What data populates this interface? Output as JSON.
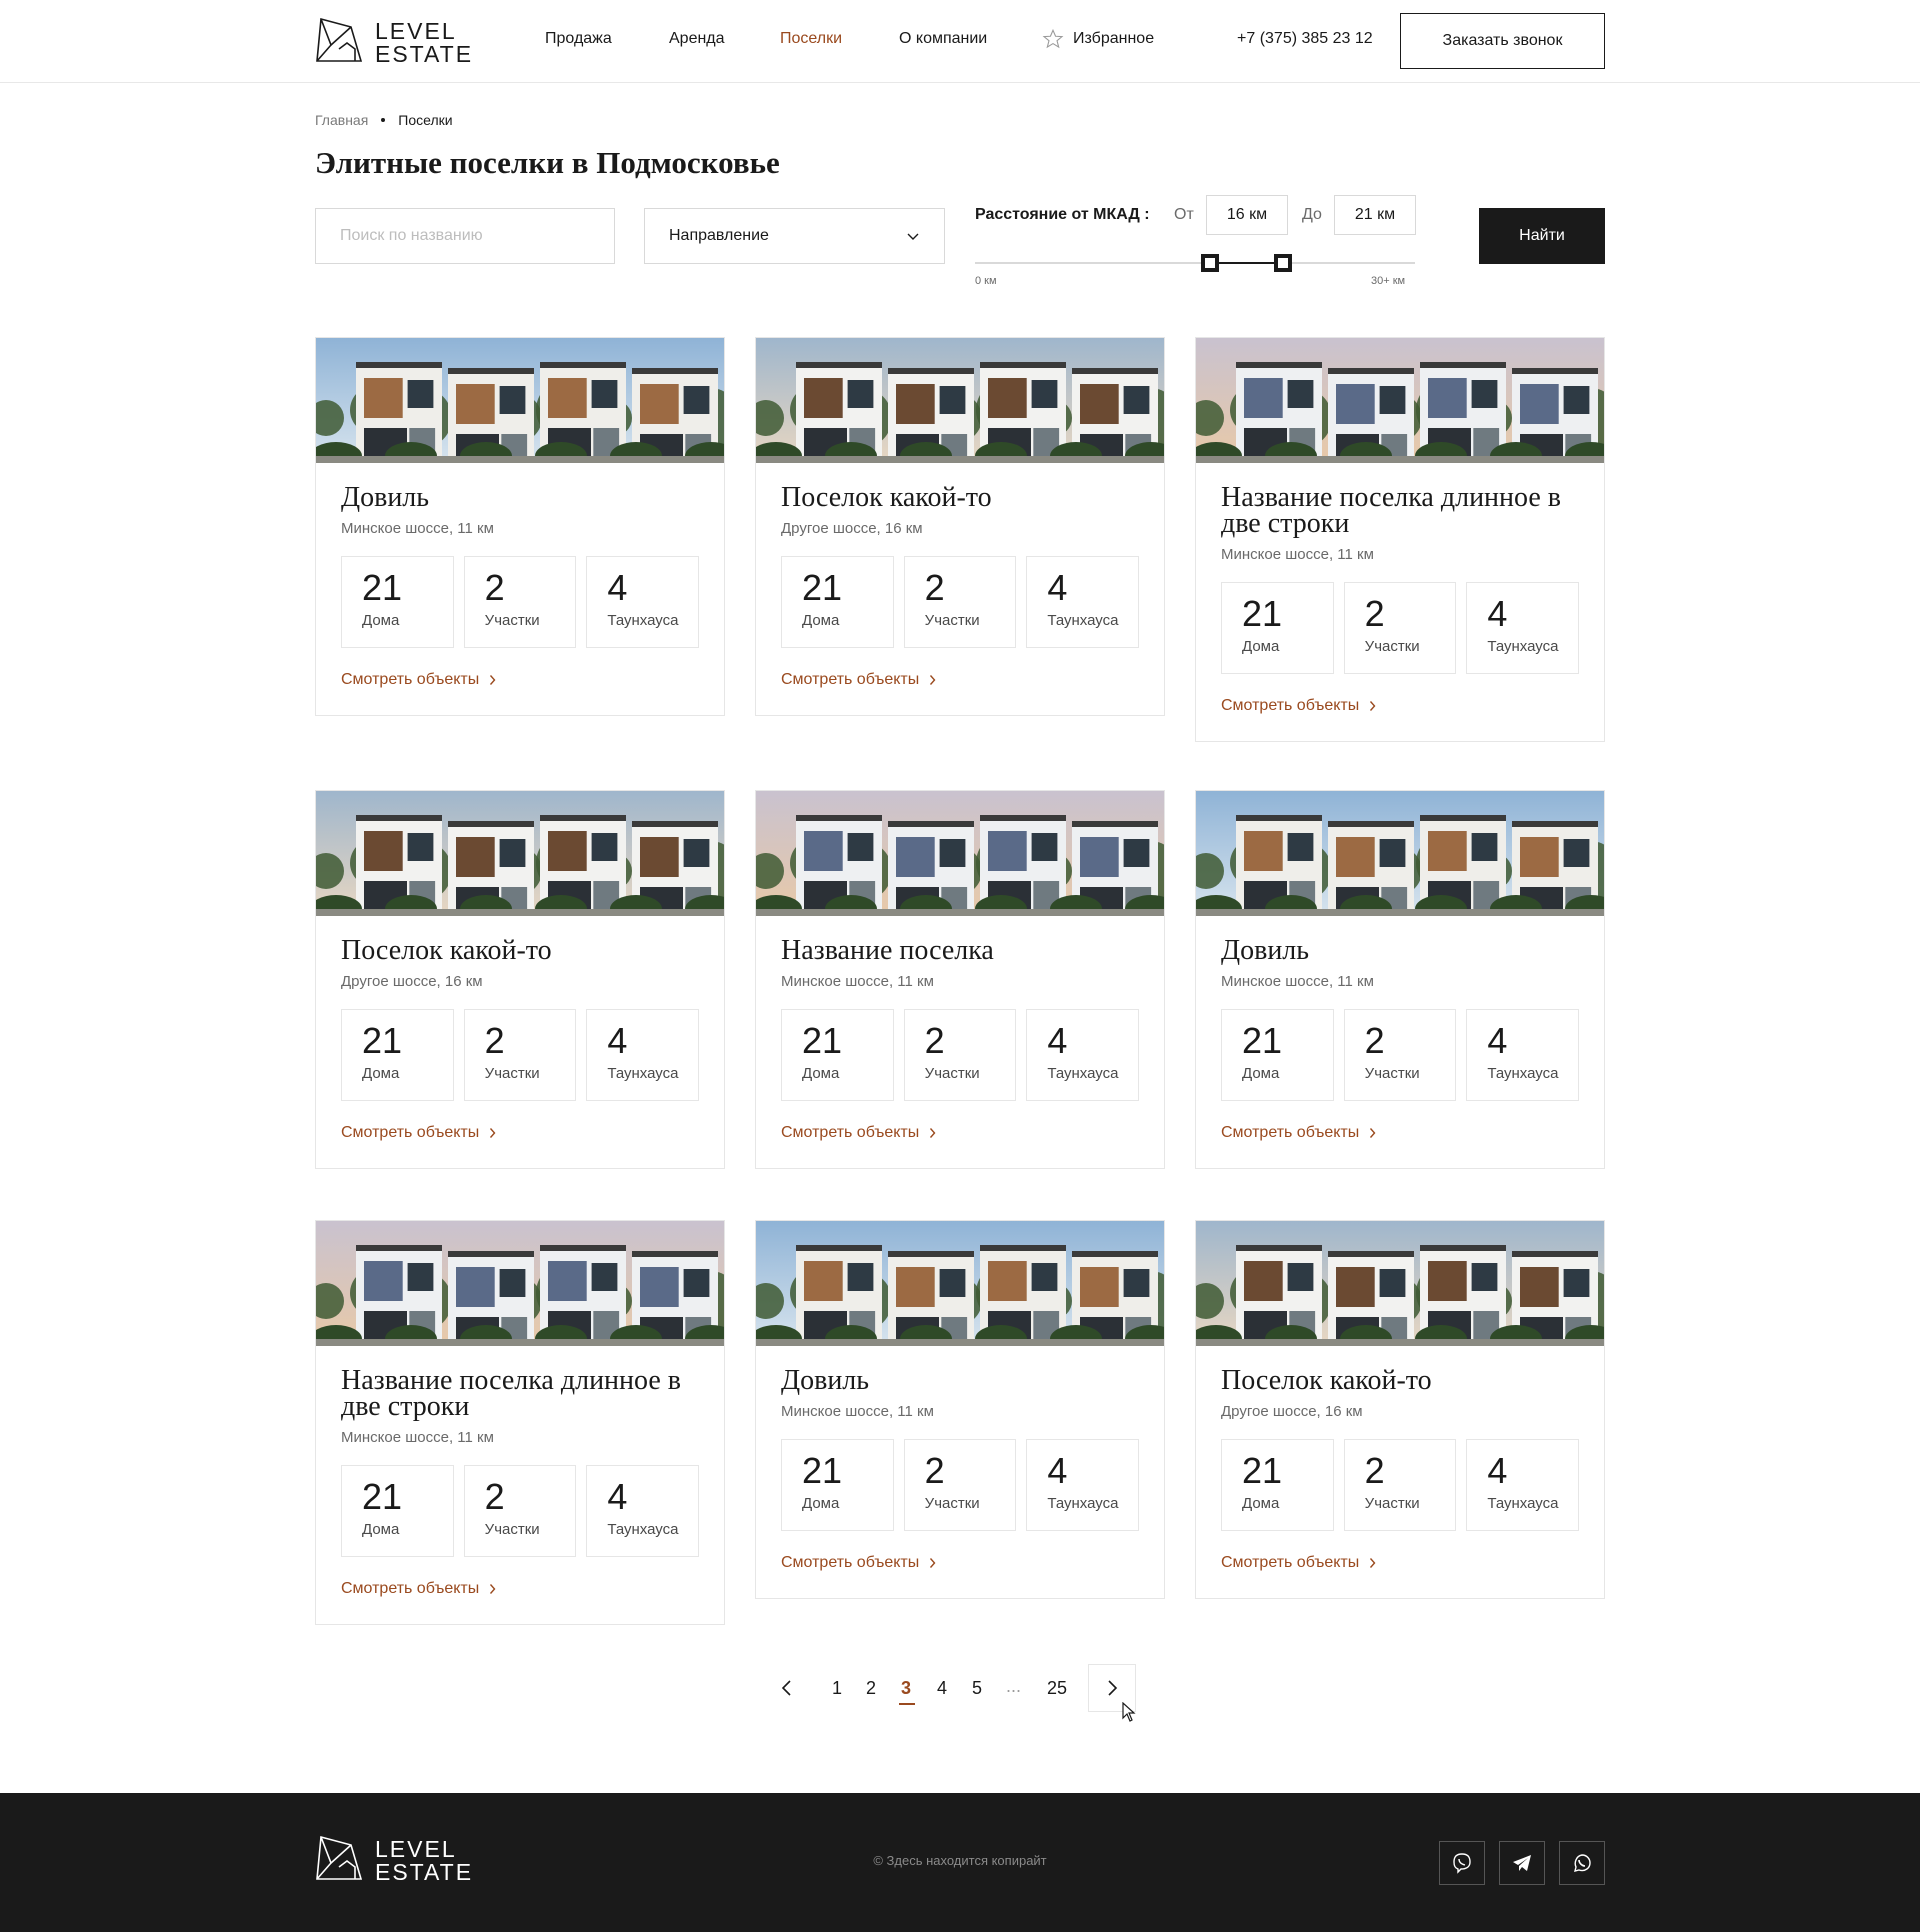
{
  "header": {
    "logo": {
      "line1": "LEVEL",
      "line2": "ESTATE"
    },
    "nav": [
      {
        "label": "Продажа",
        "active": false
      },
      {
        "label": "Аренда",
        "active": false
      },
      {
        "label": "Поселки",
        "active": true
      },
      {
        "label": "О компании",
        "active": false
      }
    ],
    "favorites_label": "Избранное",
    "favorites_icon": "star-icon",
    "phone": "+7 (375) 385 23 12",
    "call_button": "Заказать звонок"
  },
  "breadcrumb": {
    "home": "Главная",
    "current": "Поселки"
  },
  "page_title": "Элитные поселки в Подмосковье",
  "filters": {
    "search_placeholder": "Поиск по названию",
    "direction_label": "Направление",
    "direction_icon": "chevron-down-icon",
    "distance_label": "Расстояние от МКАД :",
    "from_label": "От",
    "from_value": "16 км",
    "to_label": "До",
    "to_value": "21 км",
    "range_min_label": "0 км",
    "range_max_label": "30+ км",
    "range_low_km": 16,
    "range_high_km": 21,
    "range_max_km": 30,
    "find_button": "Найти"
  },
  "stat_labels": {
    "houses": "Дома",
    "plots": "Участки",
    "townhouses": "Таунхауса"
  },
  "view_link": "Смотреть объекты",
  "cards": [
    {
      "title": "Довиль",
      "subtitle": "Минское шоссе, 11 км",
      "houses": "21",
      "plots": "2",
      "townhouses": "4",
      "image": "townhouse-wood-facade"
    },
    {
      "title": "Поселок какой-то",
      "subtitle": "Другое шоссе, 16 км",
      "houses": "21",
      "plots": "2",
      "townhouses": "4",
      "image": "townhouse-row-modern"
    },
    {
      "title": "Название поселка длинное в две строки",
      "subtitle": "Минское шоссе, 11 км",
      "houses": "21",
      "plots": "2",
      "townhouses": "4",
      "image": "townhouse-sunset"
    },
    {
      "title": "Поселок какой-то",
      "subtitle": "Другое шоссе, 16 км",
      "houses": "21",
      "plots": "2",
      "townhouses": "4",
      "image": "townhouse-row-modern"
    },
    {
      "title": "Название поселка",
      "subtitle": "Минское шоссе, 11 км",
      "houses": "21",
      "plots": "2",
      "townhouses": "4",
      "image": "townhouse-sunset"
    },
    {
      "title": "Довиль",
      "subtitle": "Минское шоссе, 11 км",
      "houses": "21",
      "plots": "2",
      "townhouses": "4",
      "image": "townhouse-wood-facade"
    },
    {
      "title": "Название поселка длинное в две строки",
      "subtitle": "Минское шоссе, 11 км",
      "houses": "21",
      "plots": "2",
      "townhouses": "4",
      "image": "townhouse-sunset"
    },
    {
      "title": "Довиль",
      "subtitle": "Минское шоссе, 11 км",
      "houses": "21",
      "plots": "2",
      "townhouses": "4",
      "image": "townhouse-wood-facade"
    },
    {
      "title": "Поселок какой-то",
      "subtitle": "Другое шоссе, 16 км",
      "houses": "21",
      "plots": "2",
      "townhouses": "4",
      "image": "townhouse-row-modern"
    }
  ],
  "pagination": {
    "pages": [
      "1",
      "2",
      "3",
      "4",
      "5"
    ],
    "ellipsis": "...",
    "last": "25",
    "current": "3"
  },
  "footer": {
    "copyright": "© Здесь находится копирайт",
    "social": [
      "viber-icon",
      "telegram-icon",
      "whatsapp-icon"
    ]
  },
  "colors": {
    "accent": "#9a4a1f",
    "dark": "#1a1a1a",
    "border": "#e6e6e6"
  }
}
